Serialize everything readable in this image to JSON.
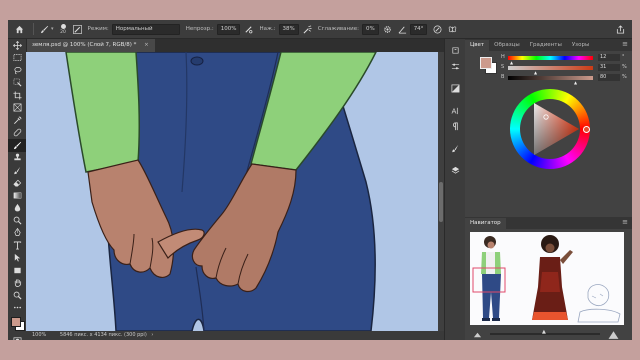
{
  "options_bar": {
    "mode_label": "Режим:",
    "mode_value": "Нормальный",
    "opacity_label": "Непрозр.:",
    "opacity_value": "100%",
    "pressure_label": "Наж.:",
    "pressure_value": "38%",
    "smoothing_label": "Сглаживание:",
    "smoothing_value": "0%",
    "angle_value": "74°",
    "brush_size": "20"
  },
  "document": {
    "tab_title": "земля.psd @ 100% (Слой 7, RGB/8) *",
    "close_glyph": "×",
    "zoom": "100%",
    "doc_info": "5846 пикс. x 4134 пикс. (300 ppi)",
    "status_arrow": "›"
  },
  "color_panel": {
    "tabs": [
      "Цвет",
      "Образцы",
      "Градиенты",
      "Узоры"
    ],
    "active_tab": 0,
    "channels": [
      {
        "label": "H",
        "value": "12",
        "unit": "°"
      },
      {
        "label": "S",
        "value": "31",
        "unit": "%"
      },
      {
        "label": "B",
        "value": "80",
        "unit": "%"
      }
    ],
    "foreground_color": "#cc9a8c",
    "background_color": "#ffffff"
  },
  "navigator": {
    "title": "Навигатор",
    "menu_glyph": "≡"
  },
  "panel_menu_glyph": "≡",
  "colors": {
    "canvas_bg": "#b0c6e6",
    "sleeve": "#8ed07a",
    "jeans": "#2f4a86",
    "skin": "#b8826e",
    "wheel_marker": "#e44d2e"
  }
}
